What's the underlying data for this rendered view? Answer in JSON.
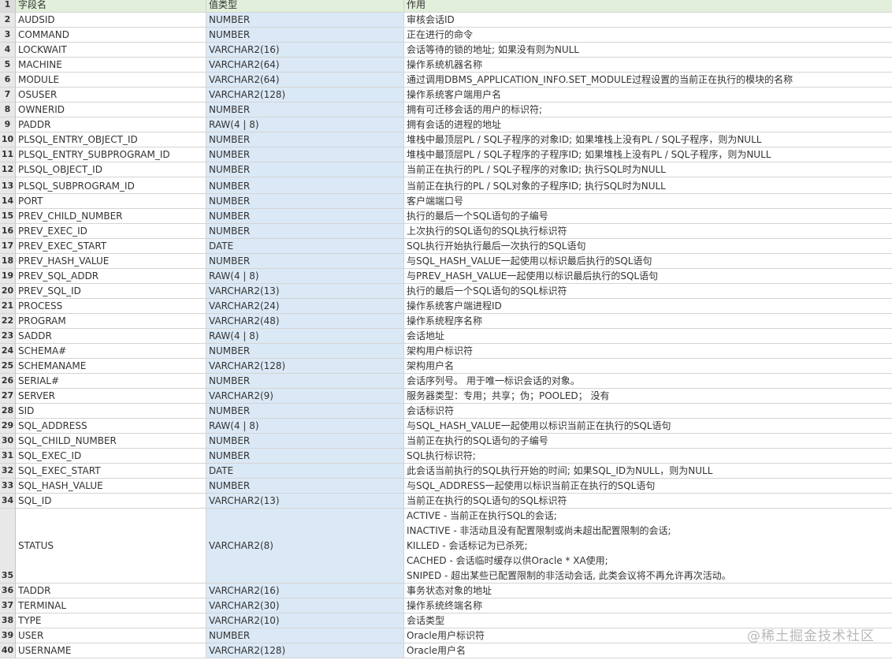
{
  "header": {
    "num": "1",
    "field": "字段名",
    "type": "值类型",
    "desc": "作用"
  },
  "rows": [
    {
      "num": "2",
      "field": "AUDSID",
      "type": "NUMBER",
      "desc": "审核会话ID"
    },
    {
      "num": "3",
      "field": "COMMAND",
      "type": "NUMBER",
      "desc": "正在进行的命令"
    },
    {
      "num": "4",
      "field": "LOCKWAIT",
      "type": "VARCHAR2(16)",
      "desc": "会话等待的锁的地址; 如果没有则为NULL"
    },
    {
      "num": "5",
      "field": "MACHINE",
      "type": "VARCHAR2(64)",
      "desc": "操作系统机器名称"
    },
    {
      "num": "6",
      "field": "MODULE",
      "type": "VARCHAR2(64)",
      "desc": "通过调用DBMS_APPLICATION_INFO.SET_MODULE过程设置的当前正在执行的模块的名称"
    },
    {
      "num": "7",
      "field": "OSUSER",
      "type": "VARCHAR2(128)",
      "desc": "操作系统客户端用户名"
    },
    {
      "num": "8",
      "field": "OWNERID",
      "type": "NUMBER",
      "desc": "拥有可迁移会话的用户的标识符;"
    },
    {
      "num": "9",
      "field": "PADDR",
      "type": "RAW(4 | 8)",
      "desc": "拥有会话的进程的地址"
    },
    {
      "num": "10",
      "field": "PLSQL_ENTRY_OBJECT_ID",
      "type": "NUMBER",
      "desc": "堆栈中最顶层PL / SQL子程序的对象ID; 如果堆栈上没有PL / SQL子程序，则为NULL"
    },
    {
      "num": "11",
      "field": "PLSQL_ENTRY_SUBPROGRAM_ID",
      "type": "NUMBER",
      "desc": "堆栈中最顶层PL / SQL子程序的子程序ID; 如果堆栈上没有PL / SQL子程序，则为NULL"
    },
    {
      "num": "12",
      "field": "PLSQL_OBJECT_ID",
      "type": "NUMBER",
      "desc": "当前正在执行的PL / SQL子程序的对象ID; 执行SQL时为NULL"
    },
    {
      "num": "13",
      "field": "PLSQL_SUBPROGRAM_ID",
      "type": "NUMBER",
      "desc": "当前正在执行的PL / SQL对象的子程序ID; 执行SQL时为NULL"
    },
    {
      "num": "14",
      "field": "PORT",
      "type": "NUMBER",
      "desc": "客户端端口号"
    },
    {
      "num": "15",
      "field": "PREV_CHILD_NUMBER",
      "type": "NUMBER",
      "desc": "执行的最后一个SQL语句的子编号"
    },
    {
      "num": "16",
      "field": "PREV_EXEC_ID",
      "type": "NUMBER",
      "desc": "上次执行的SQL语句的SQL执行标识符"
    },
    {
      "num": "17",
      "field": "PREV_EXEC_START",
      "type": "DATE",
      "desc": "SQL执行开始执行最后一次执行的SQL语句"
    },
    {
      "num": "18",
      "field": "PREV_HASH_VALUE",
      "type": "NUMBER",
      "desc": "与SQL_HASH_VALUE一起使用以标识最后执行的SQL语句"
    },
    {
      "num": "19",
      "field": "PREV_SQL_ADDR",
      "type": "RAW(4 | 8)",
      "desc": "与PREV_HASH_VALUE一起使用以标识最后执行的SQL语句"
    },
    {
      "num": "20",
      "field": "PREV_SQL_ID",
      "type": "VARCHAR2(13)",
      "desc": "执行的最后一个SQL语句的SQL标识符"
    },
    {
      "num": "21",
      "field": "PROCESS",
      "type": "VARCHAR2(24)",
      "desc": "操作系统客户端进程ID"
    },
    {
      "num": "22",
      "field": "PROGRAM",
      "type": "VARCHAR2(48)",
      "desc": "操作系统程序名称"
    },
    {
      "num": "23",
      "field": "SADDR",
      "type": "RAW(4 | 8)",
      "desc": "会话地址"
    },
    {
      "num": "24",
      "field": "SCHEMA#",
      "type": "NUMBER",
      "desc": "架构用户标识符"
    },
    {
      "num": "25",
      "field": "SCHEMANAME",
      "type": "VARCHAR2(128)",
      "desc": "架构用户名"
    },
    {
      "num": "26",
      "field": "SERIAL#",
      "type": "NUMBER",
      "desc": "会话序列号。 用于唯一标识会话的对象。"
    },
    {
      "num": "27",
      "field": "SERVER",
      "type": "VARCHAR2(9)",
      "desc": "服务器类型：专用；共享；伪；POOLED； 没有"
    },
    {
      "num": "28",
      "field": "SID",
      "type": "NUMBER",
      "desc": "会话标识符"
    },
    {
      "num": "29",
      "field": "SQL_ADDRESS",
      "type": "RAW(4 | 8)",
      "desc": "与SQL_HASH_VALUE一起使用以标识当前正在执行的SQL语句"
    },
    {
      "num": "30",
      "field": "SQL_CHILD_NUMBER",
      "type": "NUMBER",
      "desc": "当前正在执行的SQL语句的子编号"
    },
    {
      "num": "31",
      "field": "SQL_EXEC_ID",
      "type": "NUMBER",
      "desc": "SQL执行标识符;"
    },
    {
      "num": "32",
      "field": "SQL_EXEC_START",
      "type": "DATE",
      "desc": "此会话当前执行的SQL执行开始的时间; 如果SQL_ID为NULL，则为NULL"
    },
    {
      "num": "33",
      "field": "SQL_HASH_VALUE",
      "type": "NUMBER",
      "desc": "与SQL_ADDRESS一起使用以标识当前正在执行的SQL语句"
    },
    {
      "num": "34",
      "field": "SQL_ID",
      "type": "VARCHAR2(13)",
      "desc": "当前正在执行的SQL语句的SQL标识符"
    }
  ],
  "status_row": {
    "num": "35",
    "field": "STATUS",
    "type": "VARCHAR2(8)",
    "lines": [
      "ACTIVE  - 当前正在执行SQL的会话;",
      "INACTIVE  - 非活动且没有配置限制或尚未超出配置限制的会话;",
      "KILLED  - 会话标记为已杀死;",
      "CACHED  - 会话临时缓存以供Oracle * XA使用;",
      "SNIPED  - 超出某些已配置限制的非活动会话, 此类会议将不再允许再次活动。"
    ]
  },
  "rows_after": [
    {
      "num": "36",
      "field": "TADDR",
      "type": "VARCHAR2(16)",
      "desc": "事务状态对象的地址"
    },
    {
      "num": "37",
      "field": "TERMINAL",
      "type": "VARCHAR2(30)",
      "desc": "操作系统终端名称"
    },
    {
      "num": "38",
      "field": "TYPE",
      "type": "VARCHAR2(10)",
      "desc": "会话类型"
    },
    {
      "num": "39",
      "field": "USER",
      "type": "NUMBER",
      "desc": "Oracle用户标识符"
    },
    {
      "num": "40",
      "field": "USERNAME",
      "type": "VARCHAR2(128)",
      "desc": "Oracle用户名"
    }
  ],
  "watermark": "@稀土掘金技术社区"
}
